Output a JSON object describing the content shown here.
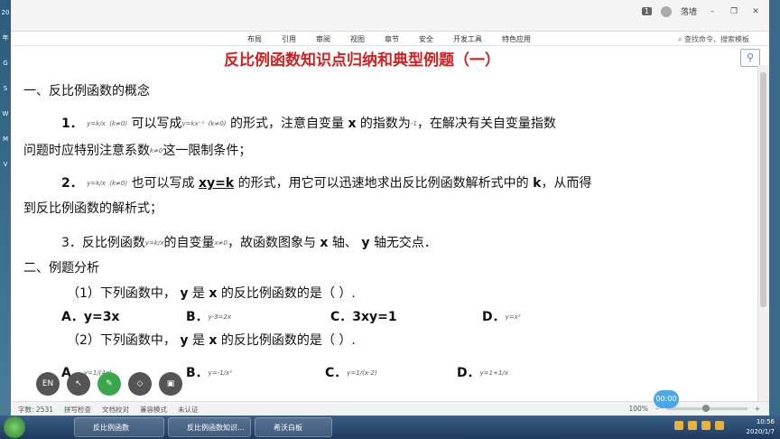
{
  "window": {
    "badge": "1",
    "user": "落墙",
    "minimize": "–",
    "restore": "❐",
    "close": "✕"
  },
  "menu": [
    "布局",
    "引用",
    "审阅",
    "视图",
    "章节",
    "安全",
    "开发工具",
    "特色应用"
  ],
  "search": "查找命令、搜索模板",
  "document": {
    "title": "反比例函数知识点归纳和典型例题（一）",
    "section1": "一、反比例函数的概念",
    "p1a": "1．",
    "p1f1": "y=k/x",
    "p1c1": "(k≠0)",
    "p1b": "可以写成",
    "p1f2": "y=kx⁻¹",
    "p1c2": "(k≠0)",
    "p1c": "的形式，注意自变量",
    "p1x": "x",
    "p1d": "的指数为",
    "p1exp": "-1",
    "p1e": "，在解决有关自变量指数",
    "p1line2a": "问题时应特别注意系数",
    "p1k": "k≠0",
    "p1line2b": "这一限制条件；",
    "p2a": "2．",
    "p2f": "y=k/x",
    "p2c": "(k≠0)",
    "p2b": "也可以写成",
    "p2xy": "xy=k",
    "p2d": "的形式，用它可以迅速地求出反比例函数解析式中的",
    "p2k": "k",
    "p2e": "，从而得",
    "p2line2": "到反比例函数的解析式；",
    "p3a": "3．反比例函数",
    "p3f": "y=k/x",
    "p3b": "的自变量",
    "p3c": "x≠0",
    "p3d": "，故函数图象与",
    "p3x": "x",
    "p3e": "轴、",
    "p3y": "y",
    "p3g": "轴无交点．",
    "section2": "二、例题分析",
    "q1": "（1）下列函数中，",
    "q1y": "y",
    "q1m": "是",
    "q1x": "x",
    "q1e": "的反比例函数的是（  ）.",
    "q1A": "A．y=3x",
    "q1B": "B．",
    "q1Bf": "y-3=2x",
    "q1C": "C．3xy=1",
    "q1D": "D．",
    "q1Df": "y=x²",
    "q2": "（2）下列函数中，",
    "q2y": "y",
    "q2m": "是",
    "q2x": "x",
    "q2e": "的反比例函数的是（  ）.",
    "q2A": "A．",
    "q2Af": "y=1/(4x)",
    "q2B": "B．",
    "q2Bf": "y=-1/x²",
    "q2C": "C．",
    "q2Cf": "y=1/(x-2)",
    "q2D": "D．",
    "q2Df": "y=1+1/x"
  },
  "status": {
    "wordcount": "字数: 2531",
    "spell": "拼写检查",
    "proof": "文档校对",
    "compat": "兼容模式",
    "auth": "未认证",
    "zoom": "100%",
    "minus": "–",
    "plus": "+"
  },
  "tools": [
    "EN",
    "↖",
    "✎",
    "◇",
    "▣"
  ],
  "timer": "00:00",
  "taskbar": {
    "items": [
      "反比例函数",
      "反比例函数知识...",
      "希沃白板"
    ],
    "time": "10:56",
    "date": "2020/1/7"
  },
  "desktop_labels": [
    "20",
    "年",
    "G",
    "S",
    "W",
    "M",
    "V"
  ]
}
